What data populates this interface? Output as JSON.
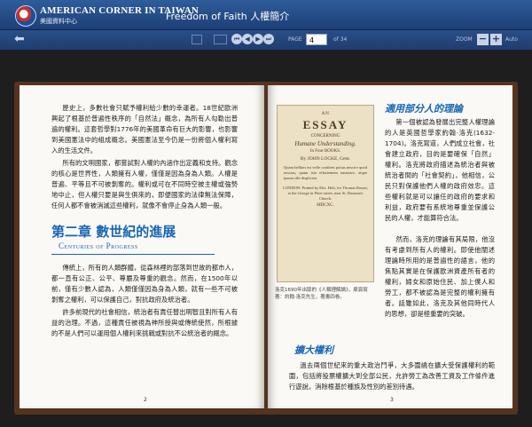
{
  "header": {
    "brand_name": "AMERICAN CORNER IN TAIWAN",
    "brand_sub": "美國資料中心",
    "doc_title": "Freedom of Faith 人權簡介"
  },
  "toolbar": {
    "page_label": "PAGE",
    "page_value": "4",
    "page_of": "of 34",
    "zoom_label": "ZOOM",
    "zoom_out": "−",
    "zoom_in": "+",
    "auto": "Auto"
  },
  "left_page": {
    "para1": "歷史上，多數社會只賦予權利給少數的幸運者。18世紀歐洲興起了根基於普遍性秩序的「自然法」概念，為所有人勾勒出普遍的權利。這套哲學對1776年的美國革命有巨大的影響，也影響到美國憲法中的組成概念。美國憲法至今仍是一份將個人權利寫入的生活文件。",
    "para2": "所有的文明國家，都嘗試對人權的內涵作出定義和支持。觀念的核心是世界性，人類擁有人權，僅僅是因為身為人類。人權是普遍、平等且不可被剝奪的。權利或可在不同時空被主權或強勢地中止，但人權只要是與生俱來的，即便國家的法律無法保障，任何人都不會被消滅這些權利，就像不會停止身為人類一般。",
    "chapter_title": "第二章 數世紀的進展",
    "section_en": "Centuries of Progress",
    "para3": "傳統上，所有的人類群體，從森林裡的部落到世故的都市人，都一直有公正、公平、尊嚴及尊重的觀念。然而，在1500年以前，僅有少數人認為，人類僅僅因為身為人類，就有一些不可被剝奪之權利，可以保護自己，對抗政府及統治者。",
    "para4": "許多前現代的社會相信，統治者有責任替出明智且對所有人有益的治理。不過，這種責任被視為神所授與或傳統使然，所根據的不是人們可以運用個人權利來挑戰或對抗不公統治者的概念。",
    "page_number": "2"
  },
  "right_page": {
    "photo": {
      "an": "AN",
      "essay": "ESSAY",
      "concerning": "CONCERNING",
      "human": "Humane Understanding.",
      "books": "In Four BOOKS.",
      "author": "By JOHN LOCKE, Gent.",
      "quote": "Quam bellum est velle confiteri potius nescire quod nescias, quam ista effutientem nauseare, atque ipsum sibi displicere.",
      "imprint": "LONDON: Printed by Eliz. Holt, for Thomas Basset, at the George in Fleet-street, near St. Dunstan's Church.",
      "year": "MDCXC."
    },
    "caption": "洛克1690年出版的《人類理解論》，扉頁寫著：約翰·洛克先生，著書四卷。",
    "section1_title": "適用部分人的理論",
    "para1": "第一個被認為發展出完整人權理論的人是英國哲學家約翰‧洛克(1632-1704)。洛克寫道，人們成立社會，社會建立政府，目的是要確保「自然」權利。洛克將政府描述為統治者與被統治者間的「社會契約」，他相信，公民只對保護他們人權的政府效忠。這些權利就是可以讓任的政府的要求和利益，政府要有系統地尊重並保護公民的人權，才能算符合法。",
    "para2": "然而，洛克的理論有其局限，他沒有考慮到所有人的權利。即使他闡述理論時所用的是普遍性的語言，他的焦點其實是在保護歐洲資產所有者的權利，婦女和原始住民、加上僕人和勞工，都不被認為是完整的權利擁有者。話雖如此，洛克及其他同時代人的思想，卻是極重要的突破。",
    "section2_title": "擴大權利",
    "para3": "過去兩個世紀來的重大政治鬥爭，大多圍繞在擴大受保護權利的範圍，包括將投票權擴大到全部公民，允許勞工為改善工資及工作條件進行遊說，消除根基於種族及性別的差別待遇。",
    "page_number": "3"
  }
}
